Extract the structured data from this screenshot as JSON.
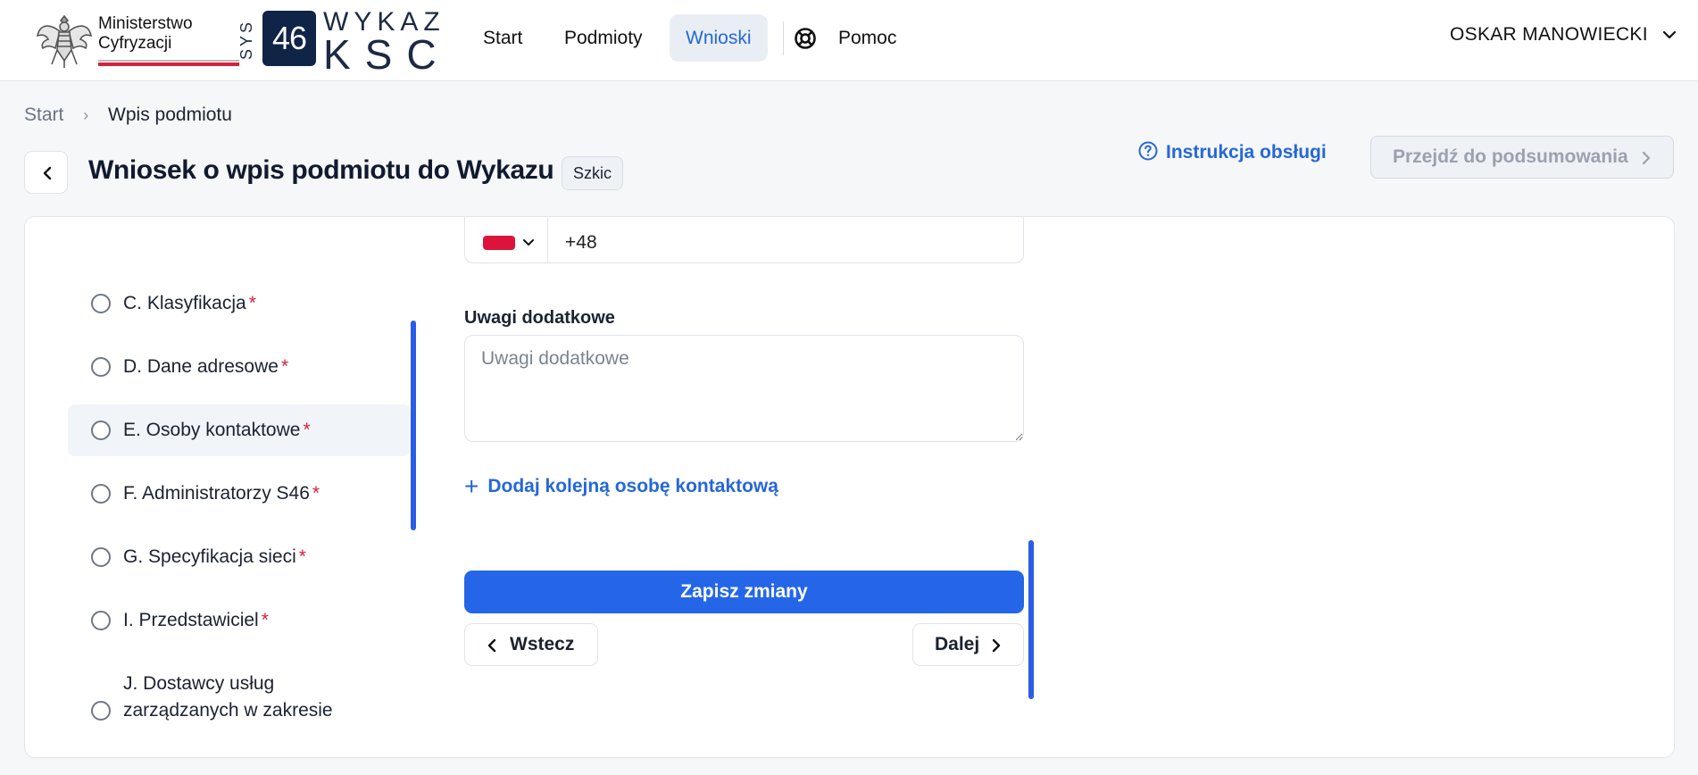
{
  "header": {
    "ministry_name_line1": "Ministerstwo",
    "ministry_name_line2": "Cyfryzacji",
    "product_logo": {
      "vertical": "SYS",
      "number": "46",
      "line1": "WYKAZ",
      "line2": "KSC"
    },
    "nav": {
      "start": "Start",
      "podmioty": "Podmioty",
      "wnioski": "Wnioski",
      "pomoc": "Pomoc"
    },
    "active_nav": "Wnioski",
    "user_name": "OSKAR MANOWIECKI"
  },
  "breadcrumb": {
    "items": [
      "Start",
      "Wpis podmiotu"
    ]
  },
  "title_row": {
    "title": "Wniosek o wpis podmiotu do Wykazu",
    "status_badge": "Szkic",
    "instructions_link": "Instrukcja obsługi",
    "summary_button": "Przejdź do podsumowania"
  },
  "steps": {
    "items": [
      {
        "label": "C. Klasyfikacja",
        "required": "*"
      },
      {
        "label": "D. Dane adresowe",
        "required": "*"
      },
      {
        "label": "E. Osoby kontaktowe",
        "required": "*"
      },
      {
        "label": "F. Administratorzy S46",
        "required": "*"
      },
      {
        "label": "G. Specyfikacja sieci",
        "required": "*"
      },
      {
        "label": "I. Przedstawiciel",
        "required": "*"
      },
      {
        "label": "J. Dostawcy usług zarządzanych w zakresie",
        "required": ""
      }
    ],
    "active_index": 2
  },
  "form": {
    "phone_prefix": "+48",
    "notes_label": "Uwagi dodatkowe",
    "notes_placeholder": "Uwagi dodatkowe",
    "notes_value": "",
    "add_contact": "Dodaj kolejną osobę kontaktową",
    "save_button": "Zapisz zmiany",
    "back_button": "Wstecz",
    "next_button": "Dalej"
  },
  "colors": {
    "accent": "#2566e8",
    "link": "#2567d9",
    "required": "#d4213d",
    "brand_dark": "#0f2447",
    "flag_red": "#dc143c"
  },
  "icons": {
    "help": "lifebuoy-icon",
    "user_menu": "chevron-down-icon",
    "back": "chevron-left-icon",
    "instructions": "question-circle-icon",
    "summary": "chevron-right-icon"
  }
}
